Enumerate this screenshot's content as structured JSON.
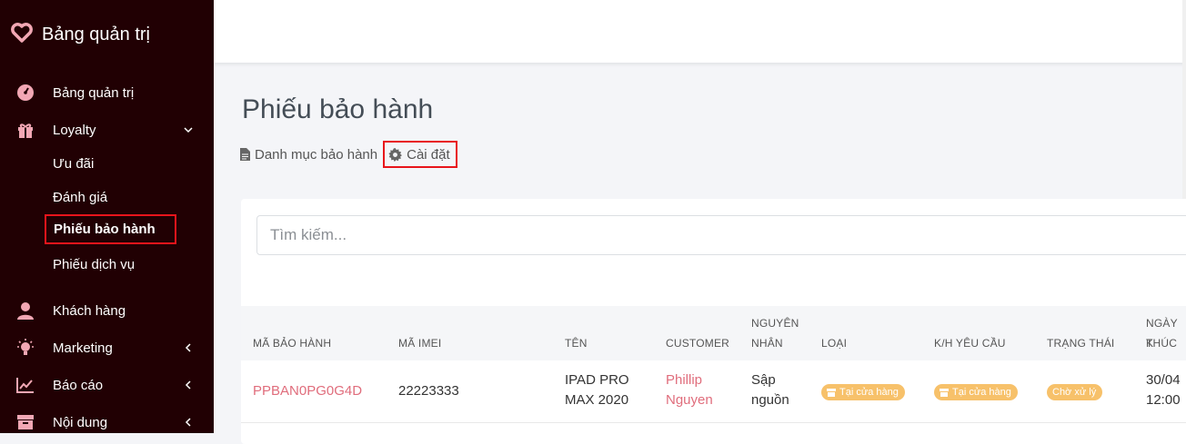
{
  "sidebar": {
    "brand": "Bảng quản trị",
    "items": [
      {
        "label": "Bảng quản trị",
        "icon": "dashboard-icon"
      },
      {
        "label": "Loyalty",
        "icon": "gift-icon"
      },
      {
        "label": "Khách hàng",
        "icon": "user-icon"
      },
      {
        "label": "Marketing",
        "icon": "lightbulb-icon"
      },
      {
        "label": "Báo cáo",
        "icon": "chart-icon"
      },
      {
        "label": "Nội dung",
        "icon": "archive-icon"
      }
    ],
    "loyalty_sub": [
      "Ưu đãi",
      "Đánh giá",
      "Phiếu bảo hành",
      "Phiếu dịch vụ"
    ]
  },
  "page": {
    "title": "Phiếu bảo hành",
    "breadcrumb_list": "Danh mục bảo hành",
    "breadcrumb_settings": "Cài đặt"
  },
  "search": {
    "placeholder": "Tìm kiếm..."
  },
  "table": {
    "headers": [
      "Mã bảo hành",
      "Mã IMEI",
      "Tên",
      "Customer",
      "Nguyên",
      "nhân",
      "Loại",
      "K/H yêu cầu",
      "Trạng thái",
      "Ngày k",
      "thúc"
    ],
    "rows": [
      {
        "code": "PPBAN0PG0G4D",
        "imei": "22223333",
        "name1": "IPAD PRO",
        "name2": "MAX 2020",
        "customer1": "Phillip",
        "customer2": "Nguyen",
        "reason1": "Sập",
        "reason2": "nguồn",
        "type": "Tại cửa hàng",
        "request": "Tại cửa hàng",
        "status": "Chờ xử lý",
        "date1": "30/04",
        "date2": "12:00"
      }
    ]
  },
  "colors": {
    "sidebar_bg": "#210003",
    "accent": "#e06d7c",
    "badge": "#f7c16a",
    "highlight": "#e8141b"
  }
}
